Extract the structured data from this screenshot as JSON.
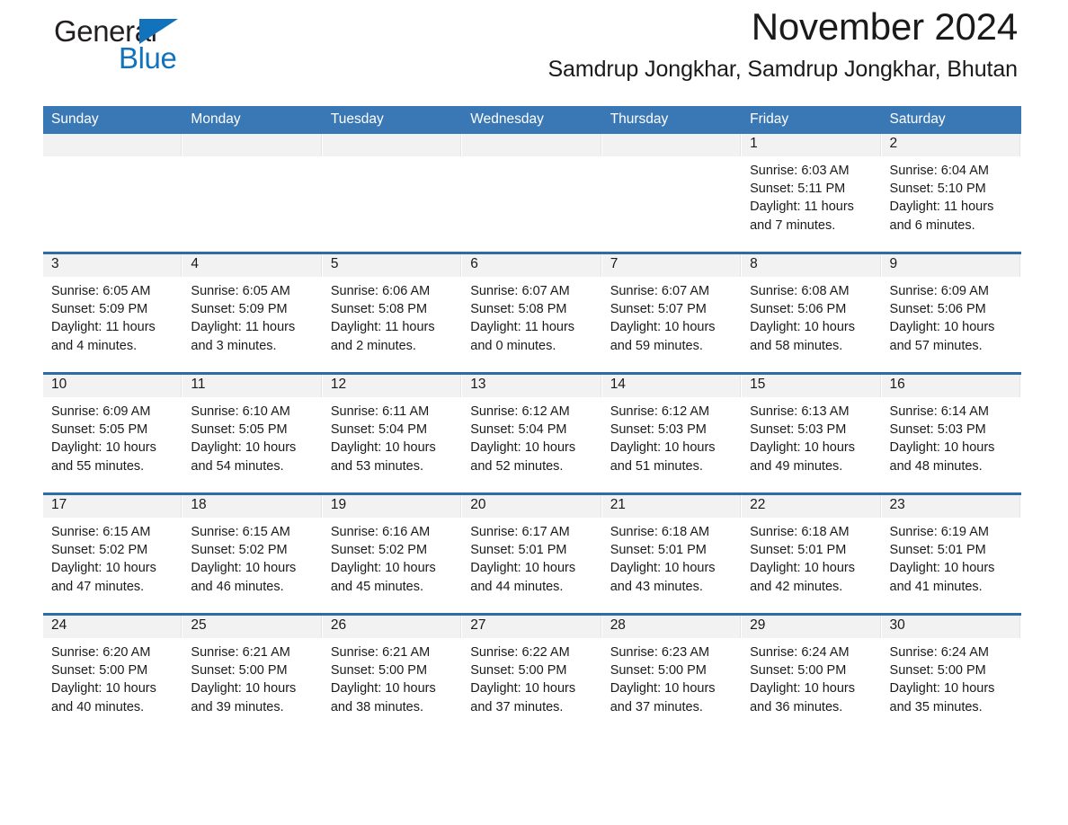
{
  "brand": {
    "name_part1": "General",
    "name_part2": "Blue",
    "accent_color": "#1272bb",
    "logo_icon": "triangle-icon"
  },
  "header": {
    "title": "November 2024",
    "subtitle": "Samdrup Jongkhar, Samdrup Jongkhar, Bhutan"
  },
  "colors": {
    "header_row_blue": "#3a78b5",
    "row_divider_blue": "#2e6da4",
    "daynum_band_gray": "#f2f2f2"
  },
  "weekday_headers": [
    "Sunday",
    "Monday",
    "Tuesday",
    "Wednesday",
    "Thursday",
    "Friday",
    "Saturday"
  ],
  "weeks": [
    [
      {
        "day": "",
        "sunrise": "",
        "sunset": "",
        "daylight_line1": "",
        "daylight_line2": ""
      },
      {
        "day": "",
        "sunrise": "",
        "sunset": "",
        "daylight_line1": "",
        "daylight_line2": ""
      },
      {
        "day": "",
        "sunrise": "",
        "sunset": "",
        "daylight_line1": "",
        "daylight_line2": ""
      },
      {
        "day": "",
        "sunrise": "",
        "sunset": "",
        "daylight_line1": "",
        "daylight_line2": ""
      },
      {
        "day": "",
        "sunrise": "",
        "sunset": "",
        "daylight_line1": "",
        "daylight_line2": ""
      },
      {
        "day": "1",
        "sunrise": "Sunrise: 6:03 AM",
        "sunset": "Sunset: 5:11 PM",
        "daylight_line1": "Daylight: 11 hours",
        "daylight_line2": "and 7 minutes."
      },
      {
        "day": "2",
        "sunrise": "Sunrise: 6:04 AM",
        "sunset": "Sunset: 5:10 PM",
        "daylight_line1": "Daylight: 11 hours",
        "daylight_line2": "and 6 minutes."
      }
    ],
    [
      {
        "day": "3",
        "sunrise": "Sunrise: 6:05 AM",
        "sunset": "Sunset: 5:09 PM",
        "daylight_line1": "Daylight: 11 hours",
        "daylight_line2": "and 4 minutes."
      },
      {
        "day": "4",
        "sunrise": "Sunrise: 6:05 AM",
        "sunset": "Sunset: 5:09 PM",
        "daylight_line1": "Daylight: 11 hours",
        "daylight_line2": "and 3 minutes."
      },
      {
        "day": "5",
        "sunrise": "Sunrise: 6:06 AM",
        "sunset": "Sunset: 5:08 PM",
        "daylight_line1": "Daylight: 11 hours",
        "daylight_line2": "and 2 minutes."
      },
      {
        "day": "6",
        "sunrise": "Sunrise: 6:07 AM",
        "sunset": "Sunset: 5:08 PM",
        "daylight_line1": "Daylight: 11 hours",
        "daylight_line2": "and 0 minutes."
      },
      {
        "day": "7",
        "sunrise": "Sunrise: 6:07 AM",
        "sunset": "Sunset: 5:07 PM",
        "daylight_line1": "Daylight: 10 hours",
        "daylight_line2": "and 59 minutes."
      },
      {
        "day": "8",
        "sunrise": "Sunrise: 6:08 AM",
        "sunset": "Sunset: 5:06 PM",
        "daylight_line1": "Daylight: 10 hours",
        "daylight_line2": "and 58 minutes."
      },
      {
        "day": "9",
        "sunrise": "Sunrise: 6:09 AM",
        "sunset": "Sunset: 5:06 PM",
        "daylight_line1": "Daylight: 10 hours",
        "daylight_line2": "and 57 minutes."
      }
    ],
    [
      {
        "day": "10",
        "sunrise": "Sunrise: 6:09 AM",
        "sunset": "Sunset: 5:05 PM",
        "daylight_line1": "Daylight: 10 hours",
        "daylight_line2": "and 55 minutes."
      },
      {
        "day": "11",
        "sunrise": "Sunrise: 6:10 AM",
        "sunset": "Sunset: 5:05 PM",
        "daylight_line1": "Daylight: 10 hours",
        "daylight_line2": "and 54 minutes."
      },
      {
        "day": "12",
        "sunrise": "Sunrise: 6:11 AM",
        "sunset": "Sunset: 5:04 PM",
        "daylight_line1": "Daylight: 10 hours",
        "daylight_line2": "and 53 minutes."
      },
      {
        "day": "13",
        "sunrise": "Sunrise: 6:12 AM",
        "sunset": "Sunset: 5:04 PM",
        "daylight_line1": "Daylight: 10 hours",
        "daylight_line2": "and 52 minutes."
      },
      {
        "day": "14",
        "sunrise": "Sunrise: 6:12 AM",
        "sunset": "Sunset: 5:03 PM",
        "daylight_line1": "Daylight: 10 hours",
        "daylight_line2": "and 51 minutes."
      },
      {
        "day": "15",
        "sunrise": "Sunrise: 6:13 AM",
        "sunset": "Sunset: 5:03 PM",
        "daylight_line1": "Daylight: 10 hours",
        "daylight_line2": "and 49 minutes."
      },
      {
        "day": "16",
        "sunrise": "Sunrise: 6:14 AM",
        "sunset": "Sunset: 5:03 PM",
        "daylight_line1": "Daylight: 10 hours",
        "daylight_line2": "and 48 minutes."
      }
    ],
    [
      {
        "day": "17",
        "sunrise": "Sunrise: 6:15 AM",
        "sunset": "Sunset: 5:02 PM",
        "daylight_line1": "Daylight: 10 hours",
        "daylight_line2": "and 47 minutes."
      },
      {
        "day": "18",
        "sunrise": "Sunrise: 6:15 AM",
        "sunset": "Sunset: 5:02 PM",
        "daylight_line1": "Daylight: 10 hours",
        "daylight_line2": "and 46 minutes."
      },
      {
        "day": "19",
        "sunrise": "Sunrise: 6:16 AM",
        "sunset": "Sunset: 5:02 PM",
        "daylight_line1": "Daylight: 10 hours",
        "daylight_line2": "and 45 minutes."
      },
      {
        "day": "20",
        "sunrise": "Sunrise: 6:17 AM",
        "sunset": "Sunset: 5:01 PM",
        "daylight_line1": "Daylight: 10 hours",
        "daylight_line2": "and 44 minutes."
      },
      {
        "day": "21",
        "sunrise": "Sunrise: 6:18 AM",
        "sunset": "Sunset: 5:01 PM",
        "daylight_line1": "Daylight: 10 hours",
        "daylight_line2": "and 43 minutes."
      },
      {
        "day": "22",
        "sunrise": "Sunrise: 6:18 AM",
        "sunset": "Sunset: 5:01 PM",
        "daylight_line1": "Daylight: 10 hours",
        "daylight_line2": "and 42 minutes."
      },
      {
        "day": "23",
        "sunrise": "Sunrise: 6:19 AM",
        "sunset": "Sunset: 5:01 PM",
        "daylight_line1": "Daylight: 10 hours",
        "daylight_line2": "and 41 minutes."
      }
    ],
    [
      {
        "day": "24",
        "sunrise": "Sunrise: 6:20 AM",
        "sunset": "Sunset: 5:00 PM",
        "daylight_line1": "Daylight: 10 hours",
        "daylight_line2": "and 40 minutes."
      },
      {
        "day": "25",
        "sunrise": "Sunrise: 6:21 AM",
        "sunset": "Sunset: 5:00 PM",
        "daylight_line1": "Daylight: 10 hours",
        "daylight_line2": "and 39 minutes."
      },
      {
        "day": "26",
        "sunrise": "Sunrise: 6:21 AM",
        "sunset": "Sunset: 5:00 PM",
        "daylight_line1": "Daylight: 10 hours",
        "daylight_line2": "and 38 minutes."
      },
      {
        "day": "27",
        "sunrise": "Sunrise: 6:22 AM",
        "sunset": "Sunset: 5:00 PM",
        "daylight_line1": "Daylight: 10 hours",
        "daylight_line2": "and 37 minutes."
      },
      {
        "day": "28",
        "sunrise": "Sunrise: 6:23 AM",
        "sunset": "Sunset: 5:00 PM",
        "daylight_line1": "Daylight: 10 hours",
        "daylight_line2": "and 37 minutes."
      },
      {
        "day": "29",
        "sunrise": "Sunrise: 6:24 AM",
        "sunset": "Sunset: 5:00 PM",
        "daylight_line1": "Daylight: 10 hours",
        "daylight_line2": "and 36 minutes."
      },
      {
        "day": "30",
        "sunrise": "Sunrise: 6:24 AM",
        "sunset": "Sunset: 5:00 PM",
        "daylight_line1": "Daylight: 10 hours",
        "daylight_line2": "and 35 minutes."
      }
    ]
  ]
}
